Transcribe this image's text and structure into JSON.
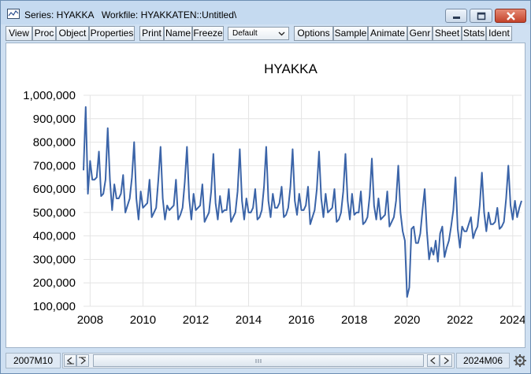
{
  "window": {
    "title": "Series: HYAKKA   Workfile: HYAKKATEN::Untitled\\",
    "icons": [
      "series-chart-icon",
      "minimize-icon",
      "maximize-icon",
      "close-icon"
    ]
  },
  "toolbar": {
    "view": "View",
    "proc": "Proc",
    "object": "Object",
    "properties": "Properties",
    "print": "Print",
    "name": "Name",
    "freeze": "Freeze",
    "combo_value": "Default",
    "options": "Options",
    "sample": "Sample",
    "animate": "Animate",
    "genr": "Genr",
    "sheet": "Sheet",
    "stats": "Stats",
    "ident": "Ident"
  },
  "bottom": {
    "start": "2007M10",
    "end": "2024M06"
  },
  "colors": {
    "line": "#3b64a8",
    "grid": "#e4e4e4",
    "background": "#ffffff"
  },
  "chart_data": {
    "type": "line",
    "title": "HYAKKA",
    "series_name": "HYAKKA",
    "x_start": "2007-10",
    "frequency": "monthly",
    "ylim": [
      100000,
      1000000
    ],
    "yticks": [
      100000,
      200000,
      300000,
      400000,
      500000,
      600000,
      700000,
      800000,
      900000,
      1000000
    ],
    "ytick_labels": [
      "100,000",
      "200,000",
      "300,000",
      "400,000",
      "500,000",
      "600,000",
      "700,000",
      "800,000",
      "900,000",
      "1,000,000"
    ],
    "xtick_labels": [
      "2008",
      "2010",
      "2012",
      "2014",
      "2016",
      "2018",
      "2020",
      "2022",
      "2024"
    ],
    "grid": true,
    "values": [
      680000,
      950000,
      580000,
      720000,
      640000,
      640000,
      650000,
      760000,
      570000,
      580000,
      640000,
      860000,
      640000,
      510000,
      620000,
      560000,
      560000,
      580000,
      660000,
      500000,
      530000,
      560000,
      650000,
      800000,
      560000,
      470000,
      590000,
      520000,
      530000,
      540000,
      640000,
      480000,
      500000,
      520000,
      640000,
      780000,
      560000,
      470000,
      530000,
      510000,
      520000,
      530000,
      640000,
      470000,
      490000,
      520000,
      630000,
      780000,
      560000,
      470000,
      580000,
      510000,
      520000,
      530000,
      620000,
      460000,
      480000,
      500000,
      590000,
      750000,
      540000,
      470000,
      570000,
      500000,
      510000,
      510000,
      600000,
      460000,
      480000,
      500000,
      590000,
      770000,
      550000,
      470000,
      560000,
      500000,
      500000,
      520000,
      600000,
      470000,
      480000,
      510000,
      610000,
      780000,
      550000,
      480000,
      580000,
      520000,
      520000,
      540000,
      610000,
      480000,
      490000,
      520000,
      610000,
      770000,
      550000,
      490000,
      580000,
      510000,
      510000,
      530000,
      610000,
      450000,
      480000,
      510000,
      600000,
      760000,
      560000,
      480000,
      580000,
      500000,
      510000,
      520000,
      600000,
      460000,
      470000,
      500000,
      590000,
      750000,
      550000,
      470000,
      580000,
      490000,
      500000,
      500000,
      590000,
      450000,
      460000,
      480000,
      570000,
      730000,
      530000,
      470000,
      560000,
      470000,
      480000,
      490000,
      590000,
      440000,
      460000,
      480000,
      550000,
      700000,
      500000,
      420000,
      380000,
      140000,
      180000,
      430000,
      440000,
      370000,
      370000,
      410000,
      510000,
      600000,
      420000,
      300000,
      350000,
      320000,
      380000,
      290000,
      410000,
      440000,
      310000,
      350000,
      380000,
      440000,
      510000,
      650000,
      430000,
      350000,
      440000,
      420000,
      420000,
      450000,
      480000,
      390000,
      420000,
      440000,
      530000,
      670000,
      500000,
      420000,
      500000,
      450000,
      450000,
      460000,
      520000,
      430000,
      440000,
      460000,
      560000,
      700000,
      530000,
      470000,
      550000,
      480000,
      520000,
      550000
    ]
  }
}
